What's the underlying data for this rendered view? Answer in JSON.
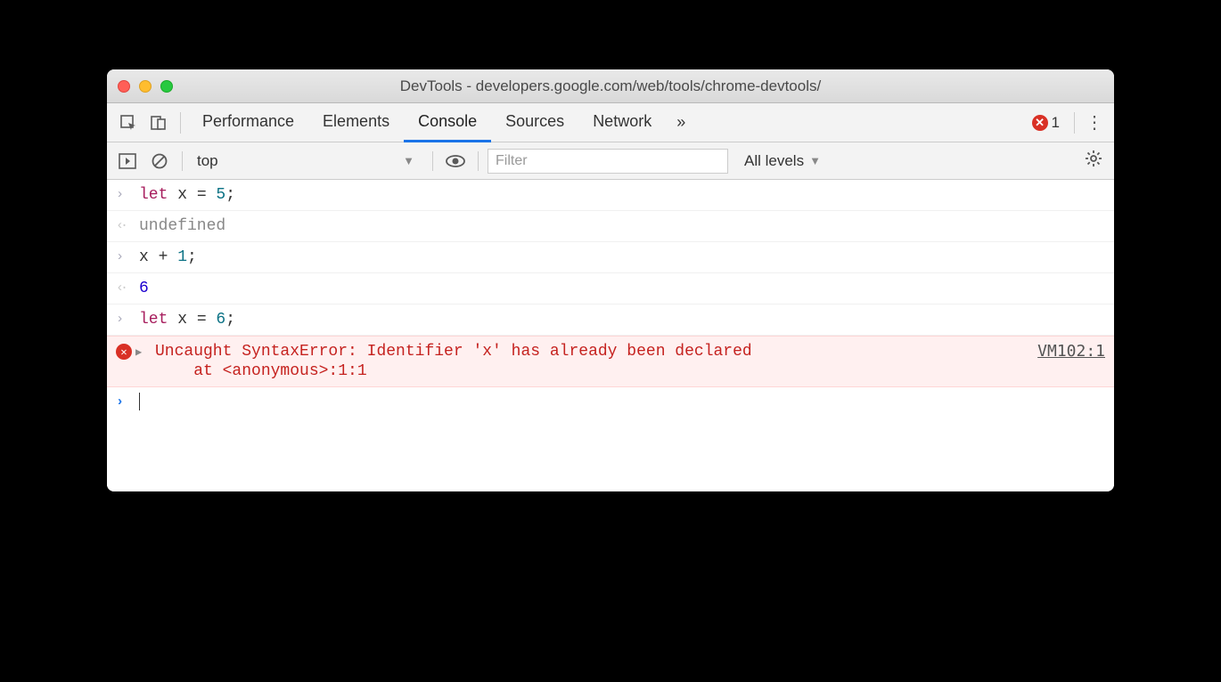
{
  "window": {
    "title": "DevTools - developers.google.com/web/tools/chrome-devtools/"
  },
  "tabs": {
    "items": [
      "Performance",
      "Elements",
      "Console",
      "Sources",
      "Network"
    ],
    "active": "Console",
    "overflow": "»",
    "error_count": "1"
  },
  "toolbar": {
    "context": "top",
    "filter_placeholder": "Filter",
    "levels": "All levels"
  },
  "console_rows": [
    {
      "type": "input",
      "tokens": [
        [
          "kw",
          "let"
        ],
        [
          "plain",
          " x "
        ],
        [
          "plain",
          "= "
        ],
        [
          "num",
          "5"
        ],
        [
          "plain",
          ";"
        ]
      ]
    },
    {
      "type": "output",
      "tokens": [
        [
          "undef",
          "undefined"
        ]
      ]
    },
    {
      "type": "input",
      "tokens": [
        [
          "plain",
          "x + "
        ],
        [
          "num",
          "1"
        ],
        [
          "plain",
          ";"
        ]
      ]
    },
    {
      "type": "output",
      "tokens": [
        [
          "resnum",
          "6"
        ]
      ]
    },
    {
      "type": "input",
      "tokens": [
        [
          "kw",
          "let"
        ],
        [
          "plain",
          " x "
        ],
        [
          "plain",
          "= "
        ],
        [
          "num",
          "6"
        ],
        [
          "plain",
          ";"
        ]
      ]
    },
    {
      "type": "error",
      "message": "Uncaught SyntaxError: Identifier 'x' has already been declared\n    at <anonymous>:1:1",
      "source": "VM102:1"
    },
    {
      "type": "prompt"
    }
  ]
}
